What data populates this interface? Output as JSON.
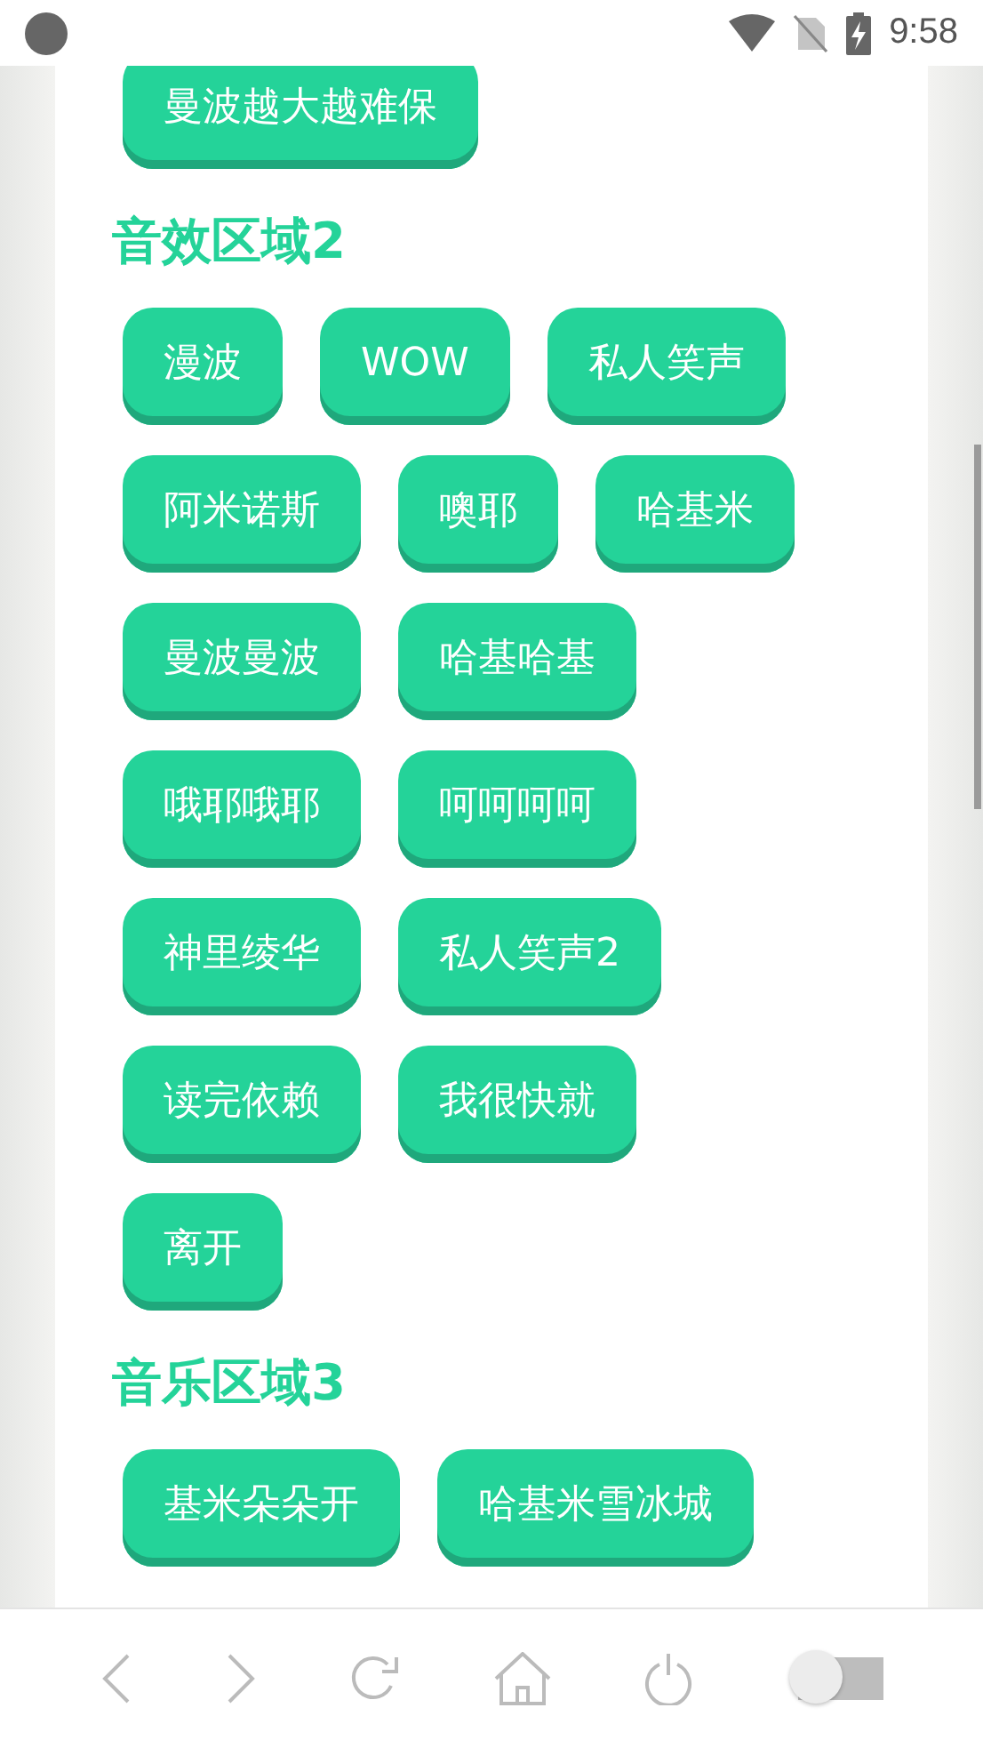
{
  "status_bar": {
    "time": "9:58"
  },
  "sections": [
    {
      "buttons": [
        "曼波越大越难保"
      ]
    },
    {
      "title": "音效区域2",
      "buttons": [
        "漫波",
        "WOW",
        "私人笑声",
        "阿米诺斯",
        "噢耶",
        "哈基米",
        "曼波曼波",
        "哈基哈基",
        "哦耶哦耶",
        "呵呵呵呵",
        "神里绫华",
        "私人笑声2",
        "读完依赖",
        "我很快就",
        "离开"
      ]
    },
    {
      "title": "音乐区域3",
      "buttons": [
        "基米朵朵开",
        "哈基米雪冰城"
      ]
    }
  ],
  "bottom_toggle": {
    "on": false
  }
}
